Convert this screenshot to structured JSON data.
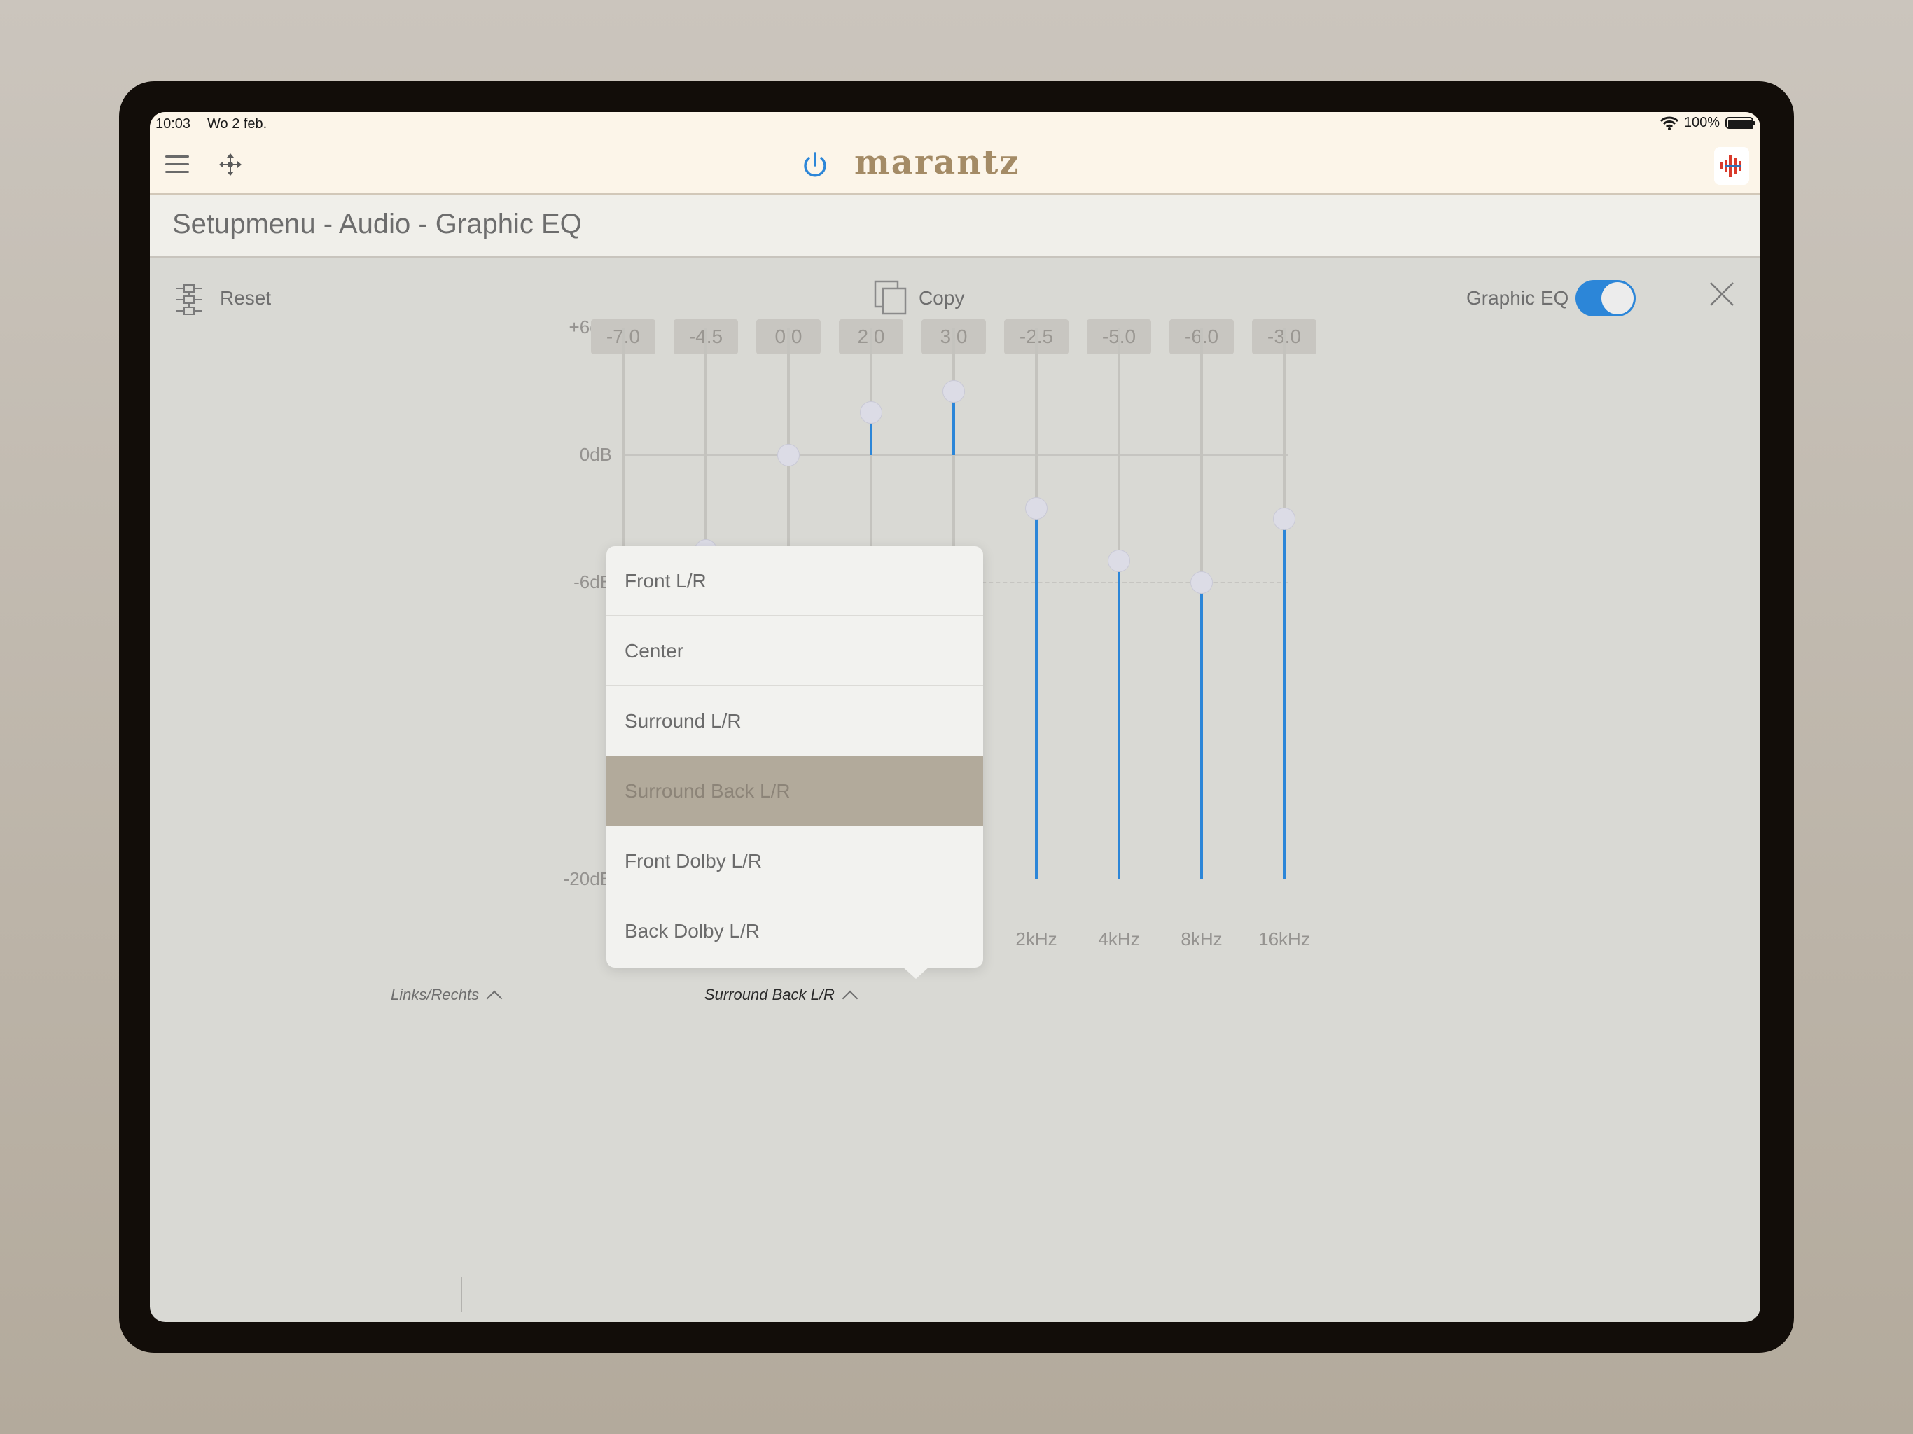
{
  "status_bar": {
    "time": "10:03",
    "date": "Wo 2 feb.",
    "battery": "100%"
  },
  "header": {
    "brand": "marantz"
  },
  "title": "Setupmenu - Audio - Graphic EQ",
  "toolbar": {
    "reset_label": "Reset",
    "copy_label": "Copy",
    "graphic_eq_label": "Graphic EQ",
    "graphic_eq_enabled": true
  },
  "eq": {
    "db_labels": [
      "+6dB",
      "0dB",
      "-6dB",
      "-20dB"
    ],
    "value_labels": [
      "-7.0",
      "-4.5",
      "0.0",
      "2.0",
      "3.0",
      "-2.5",
      "-5.0",
      "-6.0",
      "-3.0"
    ],
    "values": [
      -7.0,
      -4.5,
      0.0,
      2.0,
      3.0,
      -2.5,
      -5.0,
      -6.0,
      -3.0
    ],
    "range": [
      -20,
      6
    ],
    "frequency_labels": [
      "",
      "",
      "",
      "",
      "",
      "2kHz",
      "4kHz",
      "8kHz",
      "16kHz"
    ]
  },
  "selectors": {
    "left_label": "Links/Rechts",
    "channel_label": "Surround Back L/R"
  },
  "channel_menu": {
    "items": [
      "Front L/R",
      "Center",
      "Surround L/R",
      "Surround Back L/R",
      "Front Dolby L/R",
      "Back Dolby L/R"
    ],
    "selected_index": 3
  },
  "colors": {
    "accent": "#2c86d8",
    "brand": "#a48b66",
    "selected_item": "#b2aa9b"
  }
}
